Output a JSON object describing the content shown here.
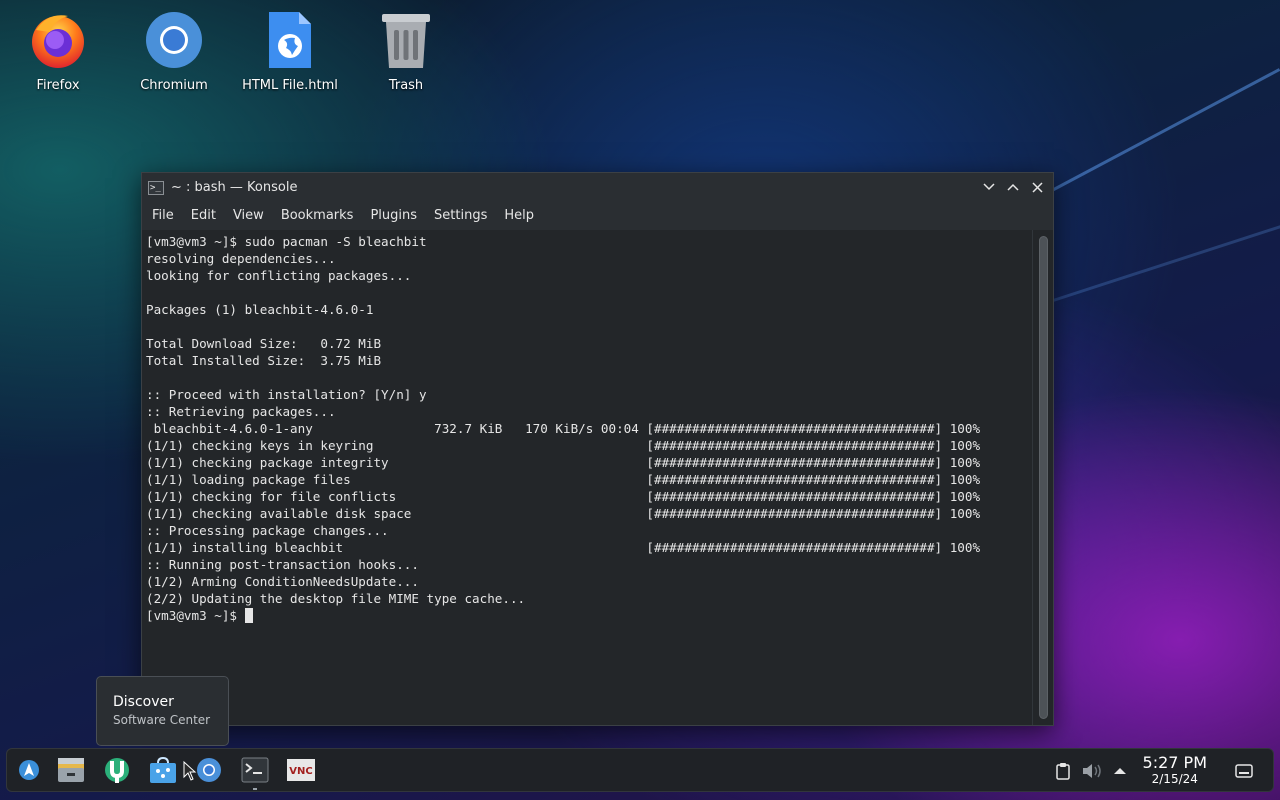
{
  "desktop": {
    "icons": [
      {
        "label": "Firefox",
        "icon": "firefox-icon"
      },
      {
        "label": "Chromium",
        "icon": "chromium-icon"
      },
      {
        "label": "HTML File.html",
        "icon": "html-file-icon"
      },
      {
        "label": "Trash",
        "icon": "trash-icon"
      }
    ]
  },
  "window": {
    "title": "~ : bash — Konsole",
    "menu": [
      "File",
      "Edit",
      "View",
      "Bookmarks",
      "Plugins",
      "Settings",
      "Help"
    ],
    "terminal_lines": [
      "[vm3@vm3 ~]$ sudo pacman -S bleachbit",
      "resolving dependencies...",
      "looking for conflicting packages...",
      "",
      "Packages (1) bleachbit-4.6.0-1",
      "",
      "Total Download Size:   0.72 MiB",
      "Total Installed Size:  3.75 MiB",
      "",
      ":: Proceed with installation? [Y/n] y",
      ":: Retrieving packages...",
      " bleachbit-4.6.0-1-any                732.7 KiB   170 KiB/s 00:04 [#####################################] 100%",
      "(1/1) checking keys in keyring                                    [#####################################] 100%",
      "(1/1) checking package integrity                                  [#####################################] 100%",
      "(1/1) loading package files                                       [#####################################] 100%",
      "(1/1) checking for file conflicts                                 [#####################################] 100%",
      "(1/1) checking available disk space                               [#####################################] 100%",
      ":: Processing package changes...",
      "(1/1) installing bleachbit                                        [#####################################] 100%",
      ":: Running post-transaction hooks...",
      "(1/2) Arming ConditionNeedsUpdate...",
      "(2/2) Updating the desktop file MIME type cache...",
      "[vm3@vm3 ~]$ "
    ]
  },
  "tooltip": {
    "title": "Discover",
    "subtitle": "Software Center"
  },
  "taskbar": {
    "apps": [
      "application-launcher-icon",
      "file-manager-icon",
      "discover-icon",
      "store-icon",
      "chromium-icon",
      "konsole-icon",
      "vnc-icon"
    ],
    "tray": [
      "clipboard-icon",
      "volume-muted-icon",
      "tray-expand-icon"
    ],
    "time": "5:27 PM",
    "date": "2/15/24"
  }
}
